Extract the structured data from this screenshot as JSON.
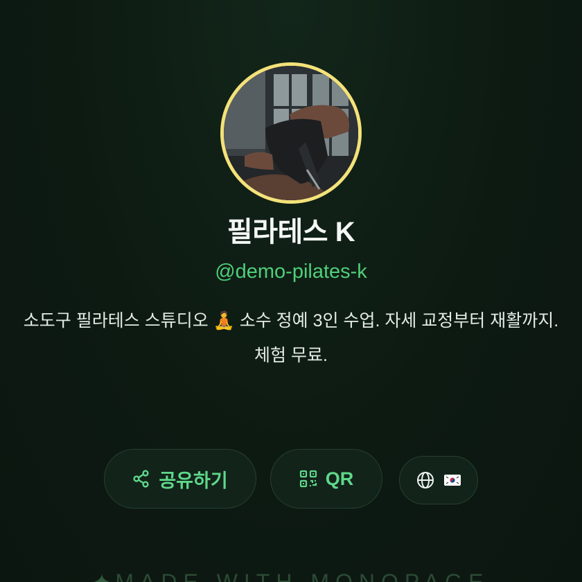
{
  "profile": {
    "name": "필라테스 K",
    "handle": "@demo-pilates-k",
    "bio": "소도구 필라테스 스튜디오 🧘 소수 정예 3인 수업. 자세 교정부터 재활까지. 체험 무료."
  },
  "actions": {
    "share_label": "공유하기",
    "qr_label": "QR",
    "language_flag": "🇰🇷"
  },
  "footer": {
    "text": "MADE WITH MONOPAGE"
  },
  "colors": {
    "background": "#0d1a12",
    "accent": "#4fcf7a",
    "avatar_ring": "#f4e27a",
    "button_bg": "#12231a"
  },
  "icons": {
    "share": "share-icon",
    "qr": "qr-code-icon",
    "language": "globe-icon",
    "footer": "sparkle-icon"
  }
}
